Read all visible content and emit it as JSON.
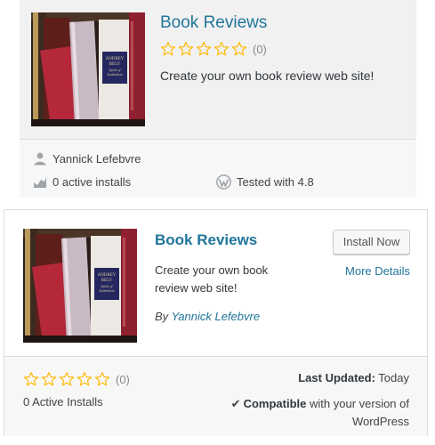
{
  "card1": {
    "title": "Book Reviews",
    "rating": {
      "stars": 0,
      "max": 5,
      "count_label": "(0)"
    },
    "description": "Create your own book review web site!",
    "author": "Yannick Lefebvre",
    "active_installs": "0 active installs",
    "tested_with": "Tested with 4.8"
  },
  "card2": {
    "title": "Book Reviews",
    "install_button": "Install Now",
    "more_details": "More Details",
    "description": "Create your own book review web site!",
    "author_prefix": "By",
    "author_name": "Yannick Lefebvre",
    "rating": {
      "stars": 0,
      "max": 5,
      "count_label": "(0)"
    },
    "active_installs": "0 Active Installs",
    "last_updated_label": "Last Updated:",
    "last_updated_value": "Today",
    "compatible_label": "Compatible",
    "compatible_text": "with your version of WordPress"
  },
  "colors": {
    "link": "#21759b",
    "star": "#ffb900",
    "card1_bg": "#f1f1f1",
    "footer_bg": "#f7f7f7"
  },
  "icons": [
    "star-empty-icon",
    "user-icon",
    "installs-chart-icon",
    "wordpress-logo-icon",
    "checkmark-icon"
  ]
}
